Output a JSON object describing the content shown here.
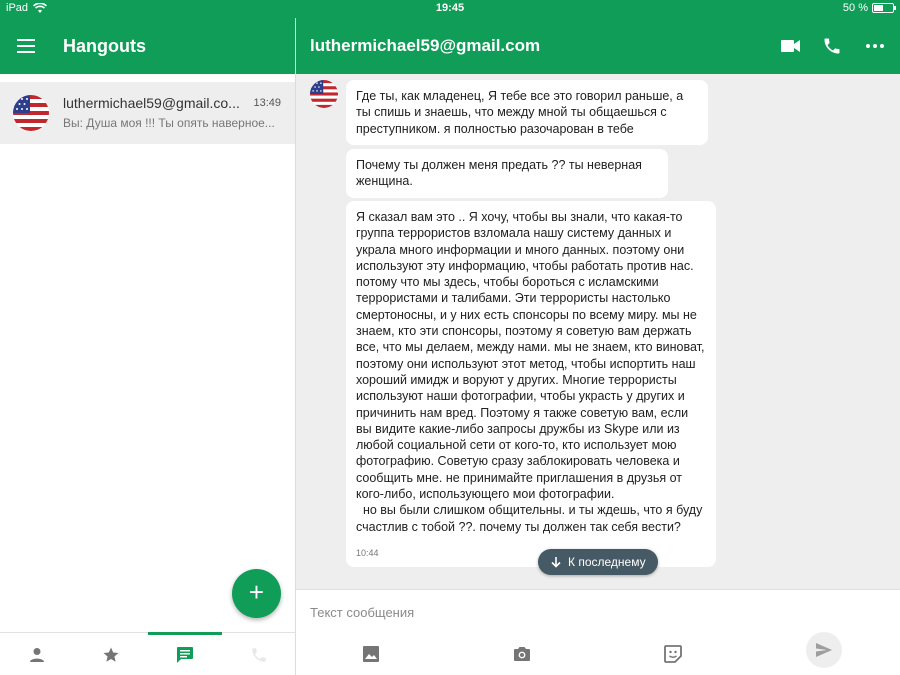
{
  "status_bar": {
    "device": "iPad",
    "time": "19:45",
    "battery": "50 %"
  },
  "app": {
    "title": "Hangouts"
  },
  "conversation_list": [
    {
      "name": "luthermichael59@gmail.co...",
      "time": "13:49",
      "snippet": "Вы: Душа моя !!! Ты опять наверное..."
    }
  ],
  "chat_header": {
    "contact": "luthermichael59@gmail.com"
  },
  "messages": [
    {
      "text": "Где ты, как младенец, Я тебе все это говорил раньше, а ты спишь и знаешь, что между мной ты общаешься с преступником. я полностью разочарован в тебе"
    },
    {
      "text": "Почему ты должен меня предать ?? ты неверная женщина."
    },
    {
      "text": "Я сказал вам это .. Я хочу, чтобы вы знали, что какая-то группа террористов взломала нашу систему данных и украла много информации и много данных. поэтому они используют эту информацию, чтобы работать против нас. потому что мы здесь, чтобы бороться с исламскими террористами и талибами. Эти террористы настолько смертоносны, и у них есть спонсоры по всему миру. мы не знаем, кто эти спонсоры, поэтому я советую вам держать все, что мы делаем, между нами. мы не знаем, кто виноват, поэтому они используют этот метод, чтобы испортить наш хороший имидж и воруют у других. Многие террористы используют наши фотографии, чтобы украсть у других и причинить нам вред. Поэтому я также советую вам, если вы видите какие-либо запросы дружбы из Skype или из любой социальной сети от кого-то, кто использует мою фотографию. Советую сразу заблокировать человека и сообщить мне. не принимайте приглашения в друзья от кого-либо, использующего мои фотографии.\n  но вы были слишком общительны. и ты ждешь, что я буду счастлив с тобой ??. почему ты должен так себя вести?",
      "time": "10:44"
    }
  ],
  "jump_button": {
    "label": "К последнему"
  },
  "composer": {
    "placeholder": "Текст сообщения"
  },
  "colors": {
    "primary": "#0f9d58",
    "chat_background": "#eeeeee",
    "jump_pill": "#455a64"
  },
  "icons": {
    "header": [
      "menu-icon"
    ],
    "chat_header": [
      "video-call-icon",
      "phone-icon",
      "more-icon"
    ],
    "bottom_nav": [
      "contacts-icon",
      "favorites-icon",
      "messages-icon",
      "calls-icon"
    ],
    "composer": [
      "image-icon",
      "camera-icon",
      "sticker-icon",
      "send-icon"
    ]
  }
}
